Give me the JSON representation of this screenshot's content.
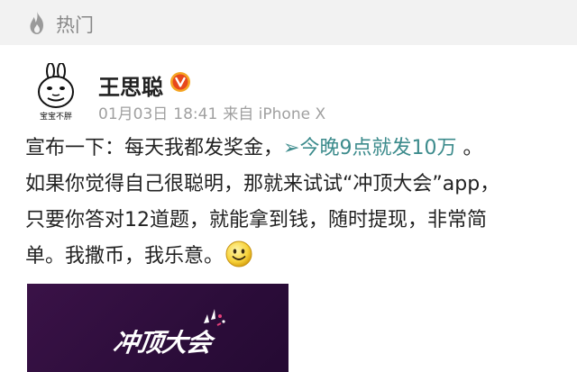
{
  "header": {
    "hot_label": "热门",
    "icon": "flame-icon"
  },
  "post": {
    "avatar_caption": "宝宝不胖",
    "user_name": "王思聪",
    "verified_icon": "verified-badge-icon",
    "date": "01月03日",
    "time": "18:41",
    "source": "来自 iPhone X",
    "text": {
      "line1_prefix": "宣布一下：每天我都发奖金，",
      "link_arrow": "➢",
      "link_text": "今晚9点就发10万",
      "line1_suffix": " 。",
      "line2": "如果你觉得自己很聪明，那就来试试“冲顶大会”app，",
      "line3": "只要你答对12道题，就能拿到钱，随时提现，非常简",
      "line4": "单。我撒币，我乐意。"
    },
    "emoji": "smile-icon",
    "image": {
      "logo_text": "冲顶大会"
    }
  },
  "colors": {
    "header_bg": "#f2f2f2",
    "link": "#3c8b8c",
    "meta": "#a0a0a0",
    "verified": "#f5a623",
    "promo_bg": "#2c0d3a"
  }
}
